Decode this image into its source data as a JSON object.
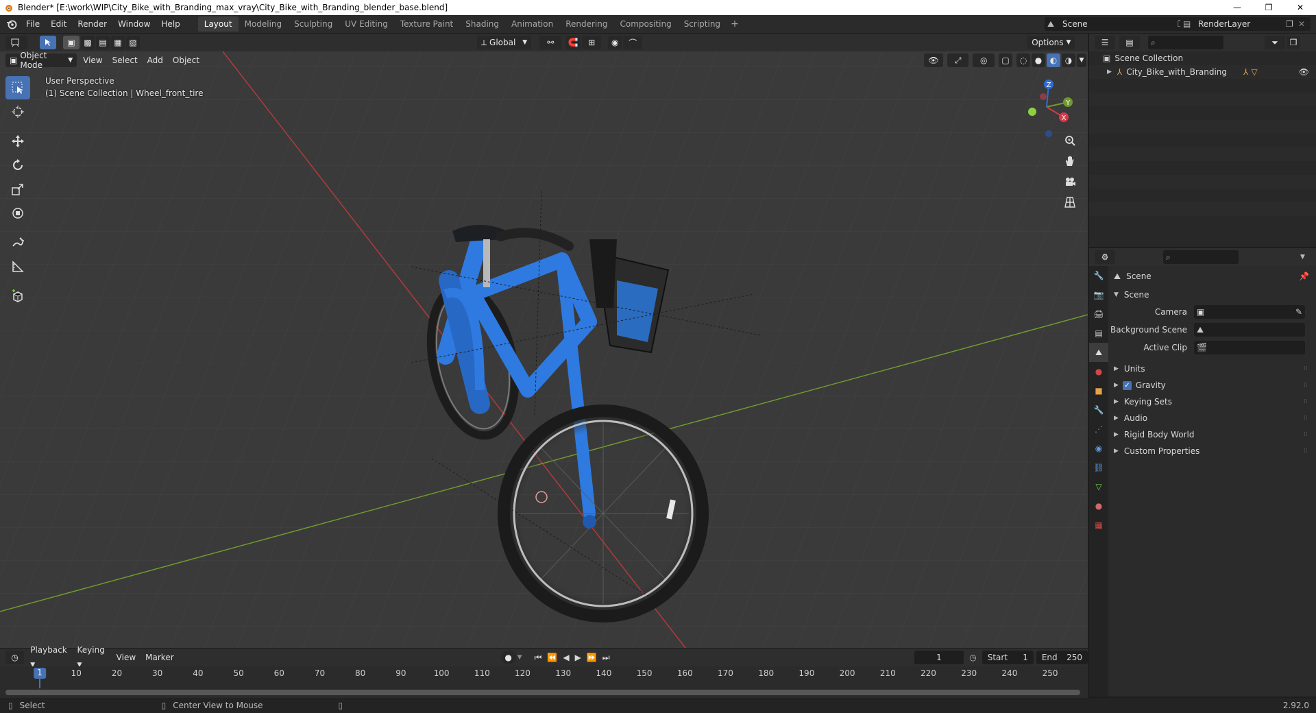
{
  "window": {
    "title": "Blender* [E:\\work\\WIP\\City_Bike_with_Branding_max_vray\\City_Bike_with_Branding_blender_base.blend]",
    "minimize": "—",
    "maximize": "❐",
    "close": "✕"
  },
  "menu": {
    "items": [
      "File",
      "Edit",
      "Render",
      "Window",
      "Help"
    ]
  },
  "workspaces": {
    "tabs": [
      "Layout",
      "Modeling",
      "Sculpting",
      "UV Editing",
      "Texture Paint",
      "Shading",
      "Animation",
      "Rendering",
      "Compositing",
      "Scripting"
    ],
    "active": "Layout",
    "add": "+"
  },
  "scene_selector": {
    "value": "Scene"
  },
  "view_layer_selector": {
    "value": "RenderLayer"
  },
  "viewport": {
    "transform_orientation": "Global",
    "options_label": "Options",
    "mode": "Object Mode",
    "menus": [
      "View",
      "Select",
      "Add",
      "Object"
    ],
    "info_line1": "User Perspective",
    "info_line2": "(1) Scene Collection | Wheel_front_tire",
    "gizmo": {
      "z": "Z",
      "y": "Y",
      "x": "X"
    },
    "colors": {
      "background": "#3a3a3a",
      "grid": "#454545",
      "x_axis": "#b33a3a",
      "y_axis": "#6f9a2f",
      "bike_blue": "#2f7ae0",
      "accent": "#4772b3"
    }
  },
  "outliner": {
    "root": "Scene Collection",
    "items": [
      {
        "name": "City_Bike_with_Branding"
      }
    ]
  },
  "properties": {
    "context_title": "Scene",
    "panel_title": "Scene",
    "camera_label": "Camera",
    "background_scene_label": "Background Scene",
    "active_clip_label": "Active Clip",
    "subpanels": [
      "Units",
      "Gravity",
      "Keying Sets",
      "Audio",
      "Rigid Body World",
      "Custom Properties"
    ],
    "gravity_checked": true
  },
  "timeline": {
    "menus": [
      "Playback",
      "Keying",
      "View",
      "Marker"
    ],
    "current_frame": "1",
    "start_label": "Start",
    "start_value": "1",
    "end_label": "End",
    "end_value": "250",
    "ruler_labels": [
      "10",
      "20",
      "30",
      "40",
      "50",
      "60",
      "70",
      "80",
      "90",
      "100",
      "110",
      "120",
      "130",
      "140",
      "150",
      "160",
      "170",
      "180",
      "190",
      "200",
      "210",
      "220",
      "230",
      "240",
      "250"
    ],
    "playhead": "1"
  },
  "statusbar": {
    "select": "Select",
    "center_view": "Center View to Mouse",
    "version": "2.92.0"
  }
}
